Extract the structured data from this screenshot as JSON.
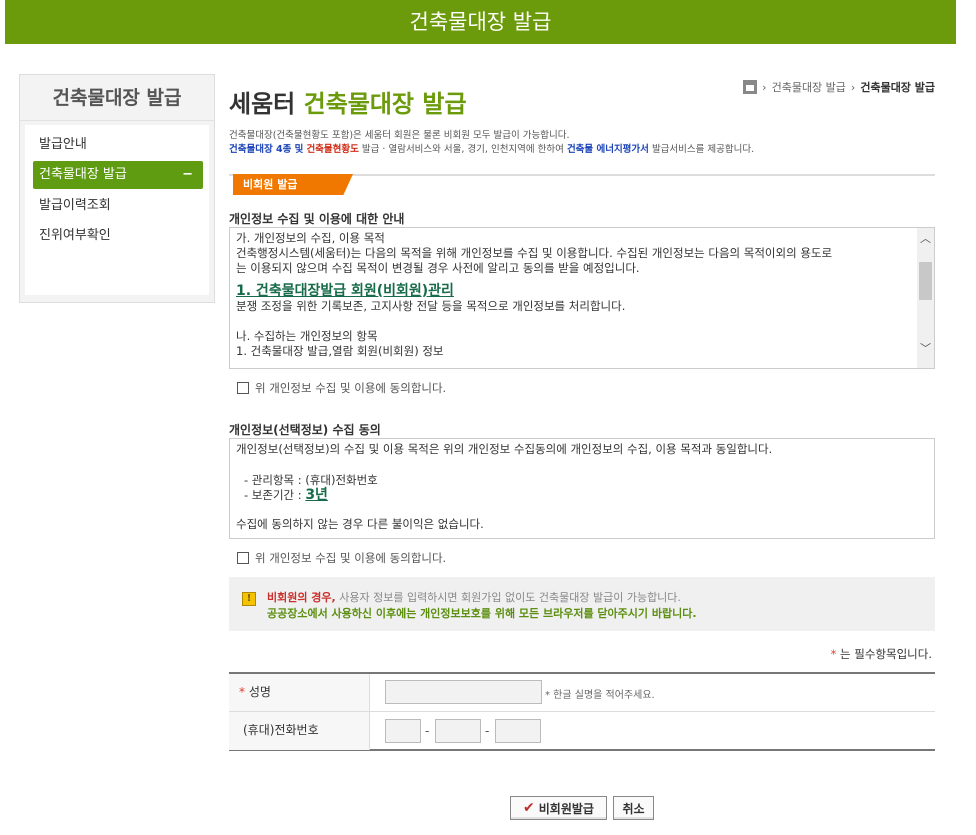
{
  "header": {
    "title": "건축물대장 발급"
  },
  "sidebar": {
    "title": "건축물대장 발급",
    "items": [
      {
        "label": "발급안내"
      },
      {
        "label": "건축물대장 발급",
        "toggle": "−"
      },
      {
        "label": "발급이력조회"
      },
      {
        "label": "진위여부확인"
      }
    ]
  },
  "breadcrumb": {
    "items": [
      "건축물대장 발급",
      "건축물대장 발급"
    ],
    "separator": "›"
  },
  "page": {
    "title_prefix": "세움터",
    "title_accent": "건축물대장 발급",
    "desc_line1": "건축물대장(건축물현황도 포함)은 세움터 회원은 물론 비회원 모두 발급이 가능합니다.",
    "desc_line2_parts": {
      "a": "건축물대장 4종 및",
      "b": "건축물현황도",
      "c": "발급 · 열람서비스와 서울, 경기, 인천지역에 한하여",
      "d": "건축물 에너지평가서",
      "e": "발급서비스를 제공합니다."
    }
  },
  "tab": {
    "label": "비회원 발급"
  },
  "privacy": {
    "title": "개인정보 수집 및 이용에 대한 안내",
    "lines": [
      "가. 개인정보의 수집, 이용 목적",
      "건축행정시스템(세움터)는 다음의 목적을 위해 개인정보를 수집 및 이용합니다. 수집된 개인정보는 다음의 목적이외의 용도로",
      "는 이용되지 않으며 수집 목적이 변경될 경우 사전에 알리고 동의를 받을 예정입니다."
    ],
    "link": "1. 건축물대장발급 회원(비회원)관리",
    "lines2": [
      "분쟁 조정을 위한 기록보존, 고지사항 전달 등을 목적으로 개인정보를 처리합니다.",
      "",
      "나. 수집하는 개인정보의 항목",
      "1. 건축물대장 발급,열람 회원(비회원) 정보"
    ],
    "agree": "위 개인정보 수집 및 이용에 동의합니다."
  },
  "optional": {
    "title": "개인정보(선택정보) 수집 동의",
    "line1": "개인정보(선택정보)의 수집 및 이용 목적은 위의 개인정보 수집동의에 개인정보의 수집, 이용 목적과 동일합니다.",
    "item1": "- 관리항목 : (휴대)전화번호",
    "item2_label": "- 보존기간 :",
    "item2_value": "3년",
    "line_end": "수집에 동의하지 않는 경우 다른 불이익은 없습니다.",
    "agree": "위 개인정보 수집 및 이용에 동의합니다."
  },
  "notice": {
    "icon": "!",
    "l1_red": "비회원의 경우,",
    "l1_rest": " 사용자 정보를 입력하시면 회원가입 없이도 건축물대장 발급이 가능합니다.",
    "l2": "공공장소에서 사용하신 이후에는 개인정보보호를 위해 모든 브라우저를 닫아주시기 바랍니다."
  },
  "required_note": {
    "star": "*",
    "text": " 는 필수항목입니다."
  },
  "form": {
    "name_star": "*",
    "name_label": " 성명",
    "name_hint": "* 한글 실명을 적어주세요.",
    "phone_label": "(휴대)전화번호",
    "dash": "-"
  },
  "buttons": {
    "check": "✔",
    "submit": "비회원발급",
    "cancel": "취소"
  },
  "colors": {
    "brand": "#6b9a0a",
    "tab": "#f07800",
    "required": "#e03a2a"
  }
}
